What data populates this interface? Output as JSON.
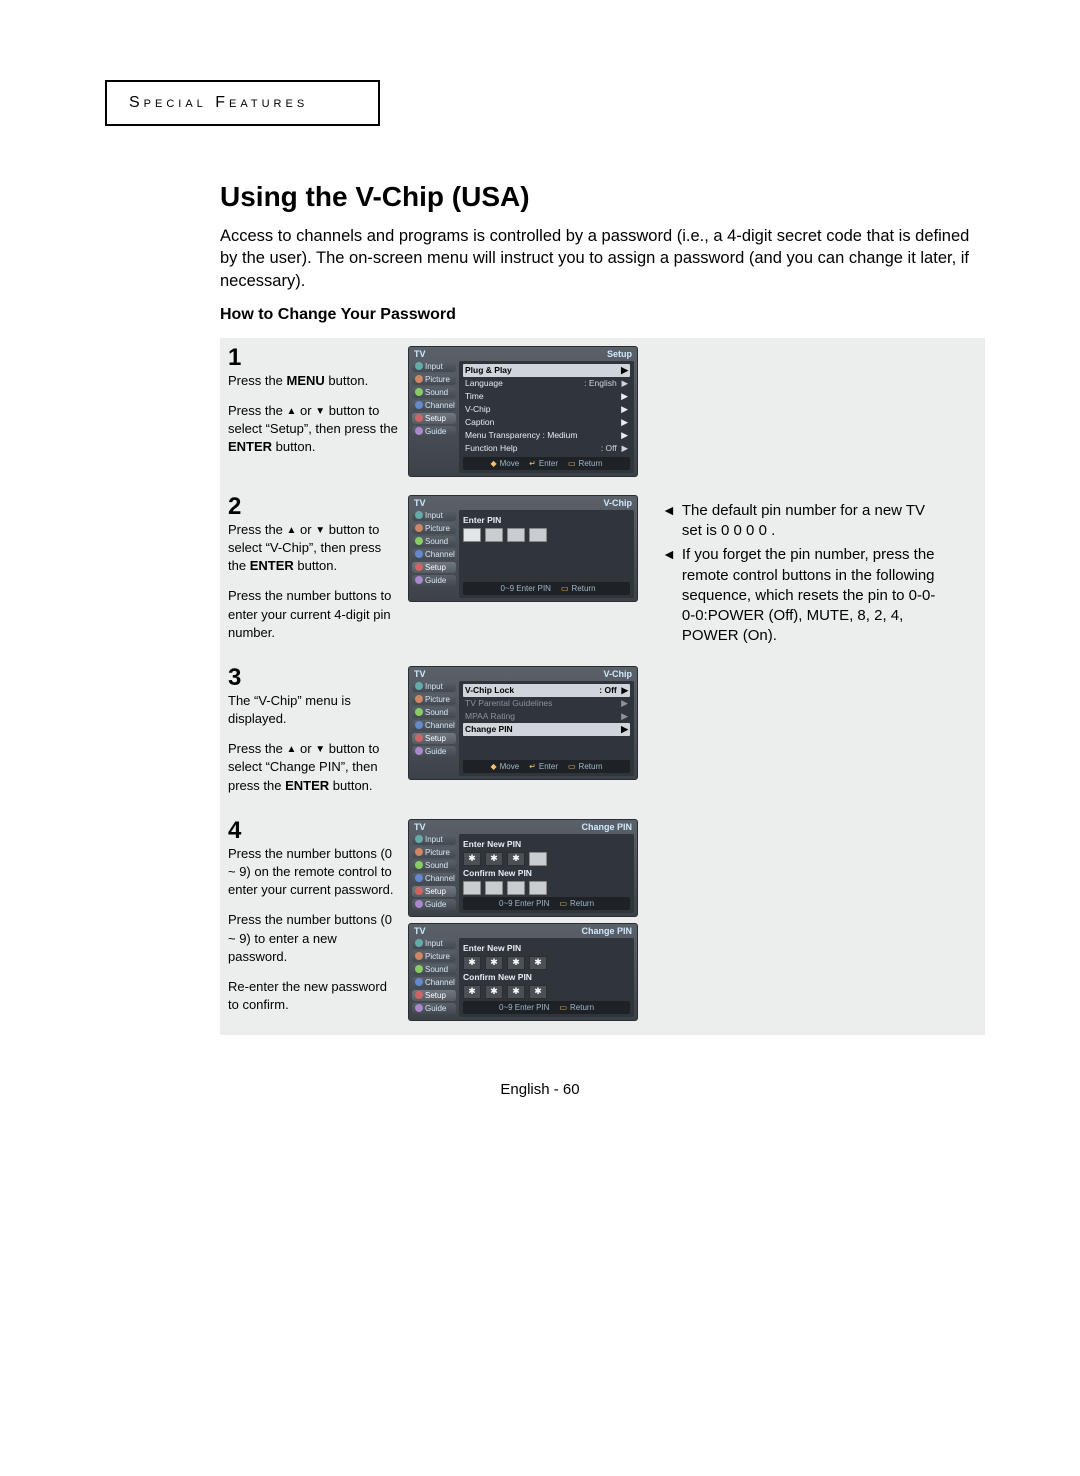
{
  "chapter": "Special Features",
  "title": "Using the V-Chip (USA)",
  "intro": "Access to channels and programs is controlled by a password (i.e., a 4-digit secret code that is defined by the user). The on-screen menu will instruct you to assign a password (and you can change it later, if necessary).",
  "subhead": "How to Change Your Password",
  "steps": {
    "s1": {
      "num": "1",
      "p1a": "Press the ",
      "p1b": "MENU",
      "p1c": " button.",
      "p2a": "Press the ",
      "p2b": " or ",
      "p2c": " button to select “Setup”, then press the ",
      "p2d": "ENTER",
      "p2e": " button."
    },
    "s2": {
      "num": "2",
      "p1a": "Press the ",
      "p1b": " or ",
      "p1c": " button to select “V-Chip”, then press the ",
      "p1d": "ENTER",
      "p1e": " button.",
      "p2": "Press the number buttons to enter your current 4-digit pin number."
    },
    "s3": {
      "num": "3",
      "p1": "The “V-Chip” menu is displayed.",
      "p2a": "Press the ",
      "p2b": " or ",
      "p2c": " button to select “Change PIN”, then press the ",
      "p2d": "ENTER",
      "p2e": " button."
    },
    "s4": {
      "num": "4",
      "p1": "Press the number buttons (0 ~ 9) on the remote control to enter your current password.",
      "p2": "Press the number buttons (0 ~ 9) to enter a new password.",
      "p3": "Re-enter the new password to confirm."
    }
  },
  "notes": {
    "n1": "The default pin number for a new TV set is  0 0 0 0 .",
    "n2": "If you forget the pin number, press the remote control buttons in the following sequence, which resets the pin to 0-0-0-0:POWER (Off), MUTE, 8, 2, 4, POWER (On)."
  },
  "osd": {
    "tv": "TV",
    "side": {
      "input": "Input",
      "picture": "Picture",
      "sound": "Sound",
      "channel": "Channel",
      "setup": "Setup",
      "guide": "Guide"
    },
    "setup": {
      "title": "Setup",
      "plugplay": "Plug & Play",
      "language_l": "Language",
      "language_v": ": English",
      "time": "Time",
      "vchip": "V-Chip",
      "caption": "Caption",
      "transp_l": "Menu Transparency :",
      "transp_v": "Medium",
      "func_l": "Function Help",
      "func_v": ": Off"
    },
    "vchip_title": "V-Chip",
    "enter_pin": "Enter PIN",
    "vchip_menu": {
      "lock_l": "V-Chip Lock",
      "lock_v": ": Off",
      "tvpg": "TV Parental Guidelines",
      "mpaa": "MPAA Rating",
      "change": "Change PIN"
    },
    "changepin_title": "Change PIN",
    "enter_new": "Enter New PIN",
    "confirm_new": "Confirm New PIN",
    "foot": {
      "move": "Move",
      "enter": "Enter",
      "ret": "Return",
      "numhint": "0~9 Enter PIN"
    }
  },
  "footer": "English - 60"
}
